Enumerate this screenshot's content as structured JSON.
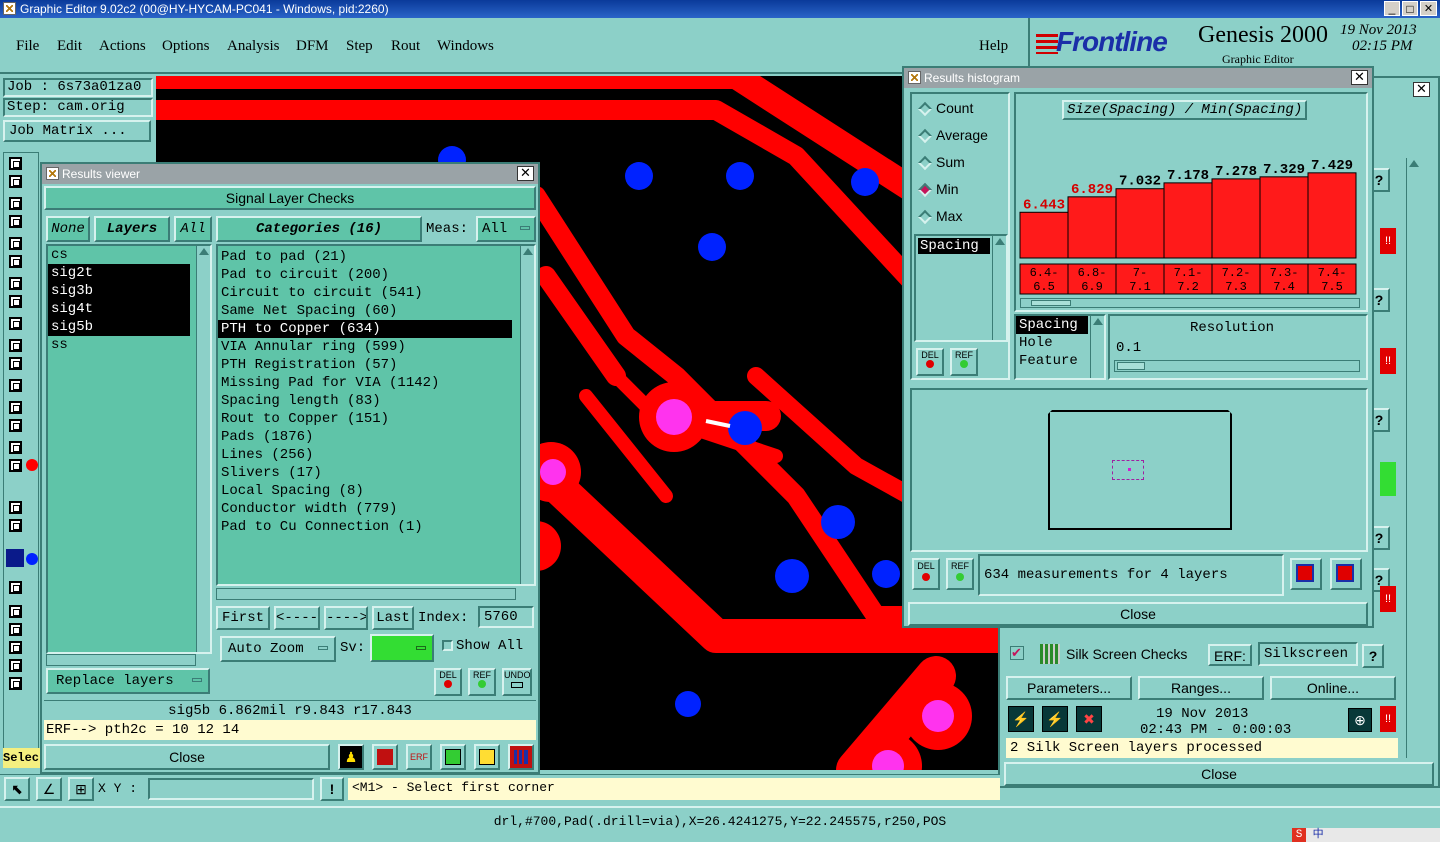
{
  "window": {
    "title": "Graphic Editor 9.02c2 (00@HY-HYCAM-PC041 - Windows, pid:2260)",
    "min": "_",
    "max": "□",
    "close": "✕"
  },
  "menu": {
    "file": "File",
    "edit": "Edit",
    "actions": "Actions",
    "options": "Options",
    "analysis": "Analysis",
    "dfm": "DFM",
    "step": "Step",
    "rout": "Rout",
    "windows": "Windows",
    "help": "Help"
  },
  "brand": {
    "logo": "Frontline",
    "product": "Genesis 2000",
    "subtitle": "Graphic Editor",
    "date": "19 Nov 2013",
    "time": "02:15 PM"
  },
  "left_panel": {
    "job": "Job : 6s73a01za0",
    "step": "Step: cam.orig",
    "job_matrix": "Job Matrix ...",
    "select_partial": "Selec"
  },
  "results_viewer": {
    "title": "Results viewer",
    "header": "Signal Layer Checks",
    "none_btn": "None",
    "layers_btn": "Layers",
    "all_btn": "All",
    "layers": [
      {
        "name": "cs",
        "selected": false
      },
      {
        "name": "sig2t",
        "selected": true
      },
      {
        "name": "sig3b",
        "selected": true
      },
      {
        "name": "sig4t",
        "selected": true
      },
      {
        "name": "sig5b",
        "selected": true
      },
      {
        "name": "ss",
        "selected": false
      }
    ],
    "categories_label": "Categories (16)",
    "meas_label": "Meas:",
    "meas_value": "All",
    "categories": [
      {
        "label": "Pad to pad (21)",
        "selected": false
      },
      {
        "label": "Pad to circuit (200)",
        "selected": false
      },
      {
        "label": "Circuit to circuit (541)",
        "selected": false
      },
      {
        "label": "Same Net Spacing (60)",
        "selected": false
      },
      {
        "label": "PTH to Copper (634)",
        "selected": true
      },
      {
        "label": "VIA Annular ring (599)",
        "selected": false
      },
      {
        "label": "PTH Registration (57)",
        "selected": false
      },
      {
        "label": "Missing Pad for VIA (1142)",
        "selected": false
      },
      {
        "label": "Spacing length (83)",
        "selected": false
      },
      {
        "label": "Rout to Copper (151)",
        "selected": false
      },
      {
        "label": "Pads (1876)",
        "selected": false
      },
      {
        "label": "Lines (256)",
        "selected": false
      },
      {
        "label": "Slivers (17)",
        "selected": false
      },
      {
        "label": "Local Spacing (8)",
        "selected": false
      },
      {
        "label": "Conductor width (779)",
        "selected": false
      },
      {
        "label": "Pad to Cu Connection (1)",
        "selected": false
      }
    ],
    "first_btn": "First",
    "prev_btn": "<----",
    "next_btn": "---->",
    "last_btn": "Last",
    "index_label": "Index:",
    "index_value": "5760",
    "auto_zoom": "Auto Zoom",
    "sv_label": "Sv:",
    "show_all": "Show All",
    "replace_layers": "Replace layers",
    "del": "DEL",
    "ref": "REF",
    "undo": "UNDO",
    "status": "sig5b 6.862mil   r9.843   r17.843",
    "erf_line": "ERF--> pth2c = 10 12 14",
    "close": "Close"
  },
  "histogram": {
    "title": "Results histogram",
    "modes": [
      {
        "label": "Count",
        "on": false
      },
      {
        "label": "Average",
        "on": false
      },
      {
        "label": "Sum",
        "on": false
      },
      {
        "label": "Min",
        "on": true
      },
      {
        "label": "Max",
        "on": false
      }
    ],
    "chart_title": "Size(Spacing) / Min(Spacing)",
    "spacing_item": "Spacing",
    "resolution_label": "Resolution",
    "resolution_value": "0.1",
    "features": [
      "Spacing",
      "Hole",
      "Feature"
    ],
    "measurements": "634 measurements for 4 layers",
    "del": "DEL",
    "ref": "REF",
    "close": "Close"
  },
  "chart_data": {
    "type": "bar",
    "title": "Size(Spacing) / Min(Spacing)",
    "categories": [
      "6.4-\n6.5",
      "6.8-\n6.9",
      "7-\n7.1",
      "7.1-\n7.2",
      "7.2-\n7.3",
      "7.3-\n7.4",
      "7.4-\n7.5"
    ],
    "values": [
      6.443,
      6.829,
      7.032,
      7.178,
      7.278,
      7.329,
      7.429
    ],
    "value_labels": [
      "6.443",
      "6.829",
      "7.032",
      "7.178",
      "7.278",
      "7.329",
      "7.429"
    ],
    "highlighted": [
      true,
      true,
      false,
      false,
      false,
      false,
      false
    ],
    "colors": {
      "bar": "#ff1a1a",
      "highlight_label": "#d40000"
    }
  },
  "silk_panel": {
    "checks_label": "Silk Screen Checks",
    "erf_label": "ERF:",
    "erf_value": "Silkscreen",
    "parameters": "Parameters...",
    "ranges": "Ranges...",
    "online": "Online...",
    "date": "19 Nov 2013",
    "time_line": "02:43 PM - 0:00:03",
    "processed": "2 Silk Screen layers processed",
    "close": "Close",
    "help": "?",
    "alert": "!!"
  },
  "bottom": {
    "xy_label": "X Y :",
    "prompt": "<M1> - Select first corner",
    "status": "drl,#700,Pad(.drill=via),X=26.4241275,Y=22.245575,r250,POS",
    "tray_s": "S",
    "tray_zh": "中"
  },
  "colors": {
    "panel": "#8cd0c8",
    "panel_green": "#5fc4a8",
    "copper": "#ff0000",
    "via": "#0022ff",
    "pad": "#ff33ee",
    "canvas": "#000000"
  }
}
